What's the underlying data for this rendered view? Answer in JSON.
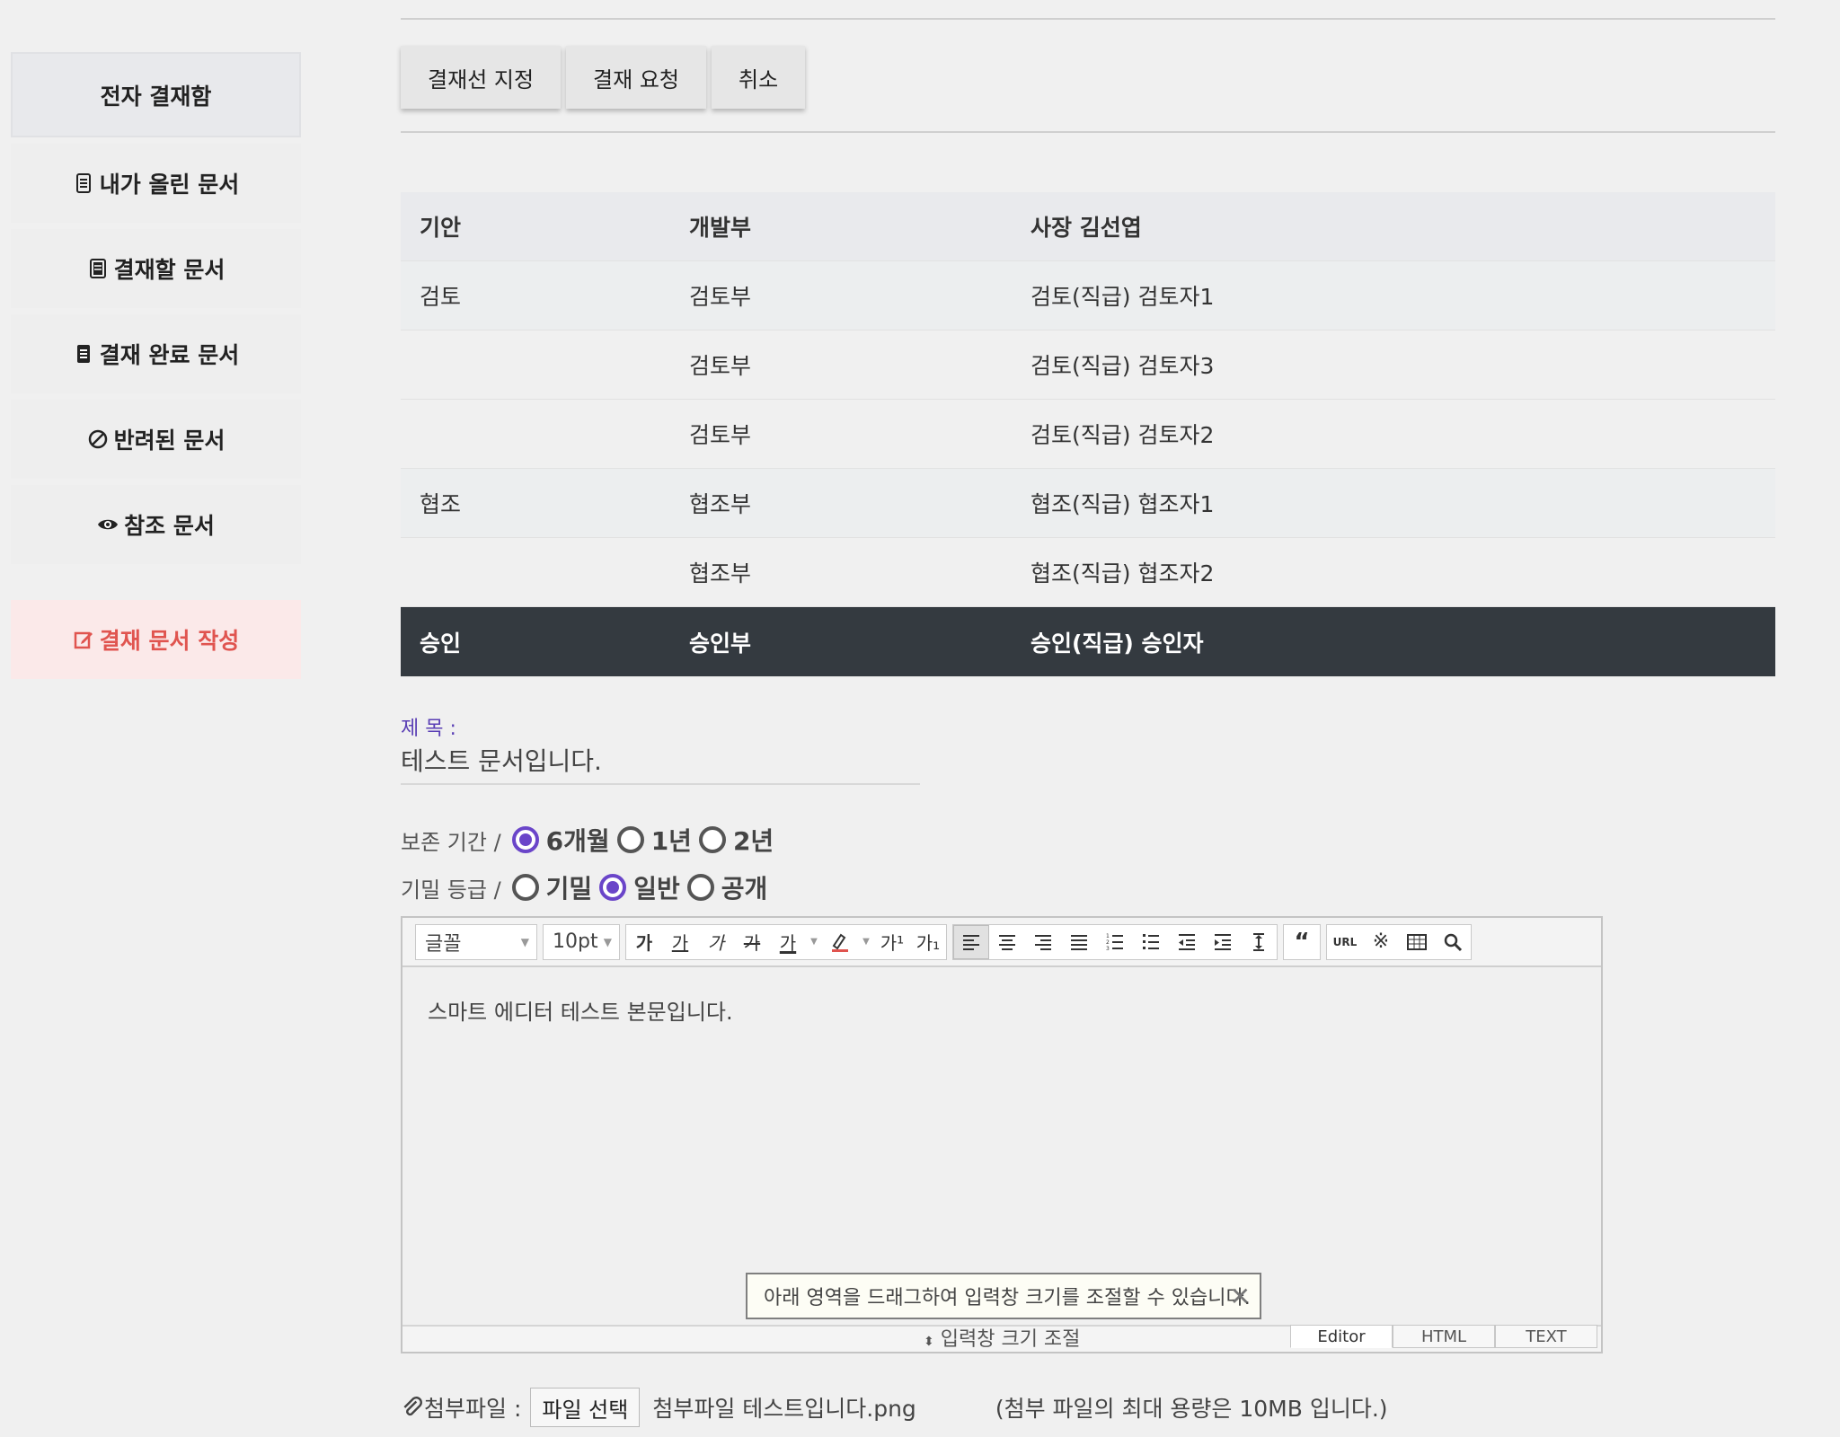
{
  "sidebar": {
    "header": "전자 결재함",
    "items": [
      {
        "label": "내가 올린 문서",
        "icon": "document-icon"
      },
      {
        "label": "결재할 문서",
        "icon": "document-filled-icon"
      },
      {
        "label": "결재 완료 문서",
        "icon": "document-done-icon"
      },
      {
        "label": "반려된 문서",
        "icon": "ban-icon"
      },
      {
        "label": "참조 문서",
        "icon": "eye-icon"
      }
    ],
    "write": {
      "label": "결재 문서 작성",
      "icon": "edit-icon",
      "color": "#e0544f"
    }
  },
  "actions": {
    "set_line": "결재선 지정",
    "request": "결재 요청",
    "cancel": "취소"
  },
  "approval_table": {
    "header": [
      "기안",
      "개발부",
      "사장 김선엽"
    ],
    "rows": [
      [
        "검토",
        "검토부",
        "검토(직급) 검토자1"
      ],
      [
        "",
        "검토부",
        "검토(직급) 검토자3"
      ],
      [
        "",
        "검토부",
        "검토(직급) 검토자2"
      ],
      [
        "협조",
        "협조부",
        "협조(직급) 협조자1"
      ],
      [
        "",
        "협조부",
        "협조(직급) 협조자2"
      ]
    ],
    "final": [
      "승인",
      "승인부",
      "승인(직급) 승인자"
    ]
  },
  "document": {
    "title_label": "제 목 :",
    "title_value": "테스트 문서입니다."
  },
  "retention": {
    "label": "보존 기간 /",
    "options": [
      "6개월",
      "1년",
      "2년"
    ],
    "selected": "6개월"
  },
  "security": {
    "label": "기밀 등급 /",
    "options": [
      "기밀",
      "일반",
      "공개"
    ],
    "selected": "일반"
  },
  "editor": {
    "font_select": "글꼴",
    "size_select": "10pt",
    "body": "스마트 에디터 테스트 본문입니다.",
    "tooltip": "아래 영역을 드래그하여 입력창 크기를 조절할 수 있습니다.",
    "resize_label": "입력창 크기 조절",
    "modes": [
      "Editor",
      "HTML",
      "TEXT"
    ],
    "active_mode": "Editor",
    "tool_text": {
      "bold": "가",
      "underline": "가",
      "italic": "가",
      "strike": "가",
      "color": "가",
      "sup": "가¹",
      "sub": "가₁",
      "url": "URL"
    }
  },
  "attachment": {
    "label": "첨부파일 :",
    "button": "파일 선택",
    "file_name": "첨부파일 테스트입니다.png",
    "limit": "(첨부 파일의 최대 용량은 10MB 입니다.)"
  },
  "colors": {
    "accent": "#6a45c9",
    "dark_row": "#343a40",
    "write": "#e0544f"
  }
}
